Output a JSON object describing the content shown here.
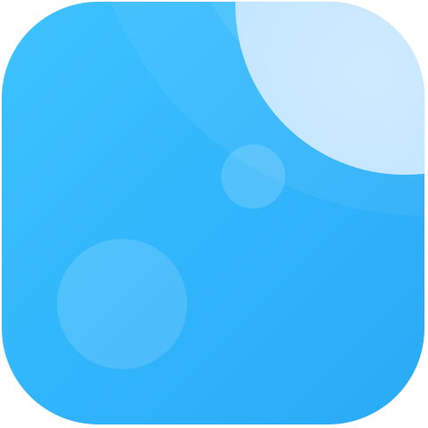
{
  "icon": {
    "semantic": "weather-app-icon",
    "colors": {
      "gradient_start": "#3ec3ff",
      "gradient_mid": "#30b4fb",
      "gradient_end": "#2aaaf5",
      "moon": "#c6e6ff"
    }
  }
}
